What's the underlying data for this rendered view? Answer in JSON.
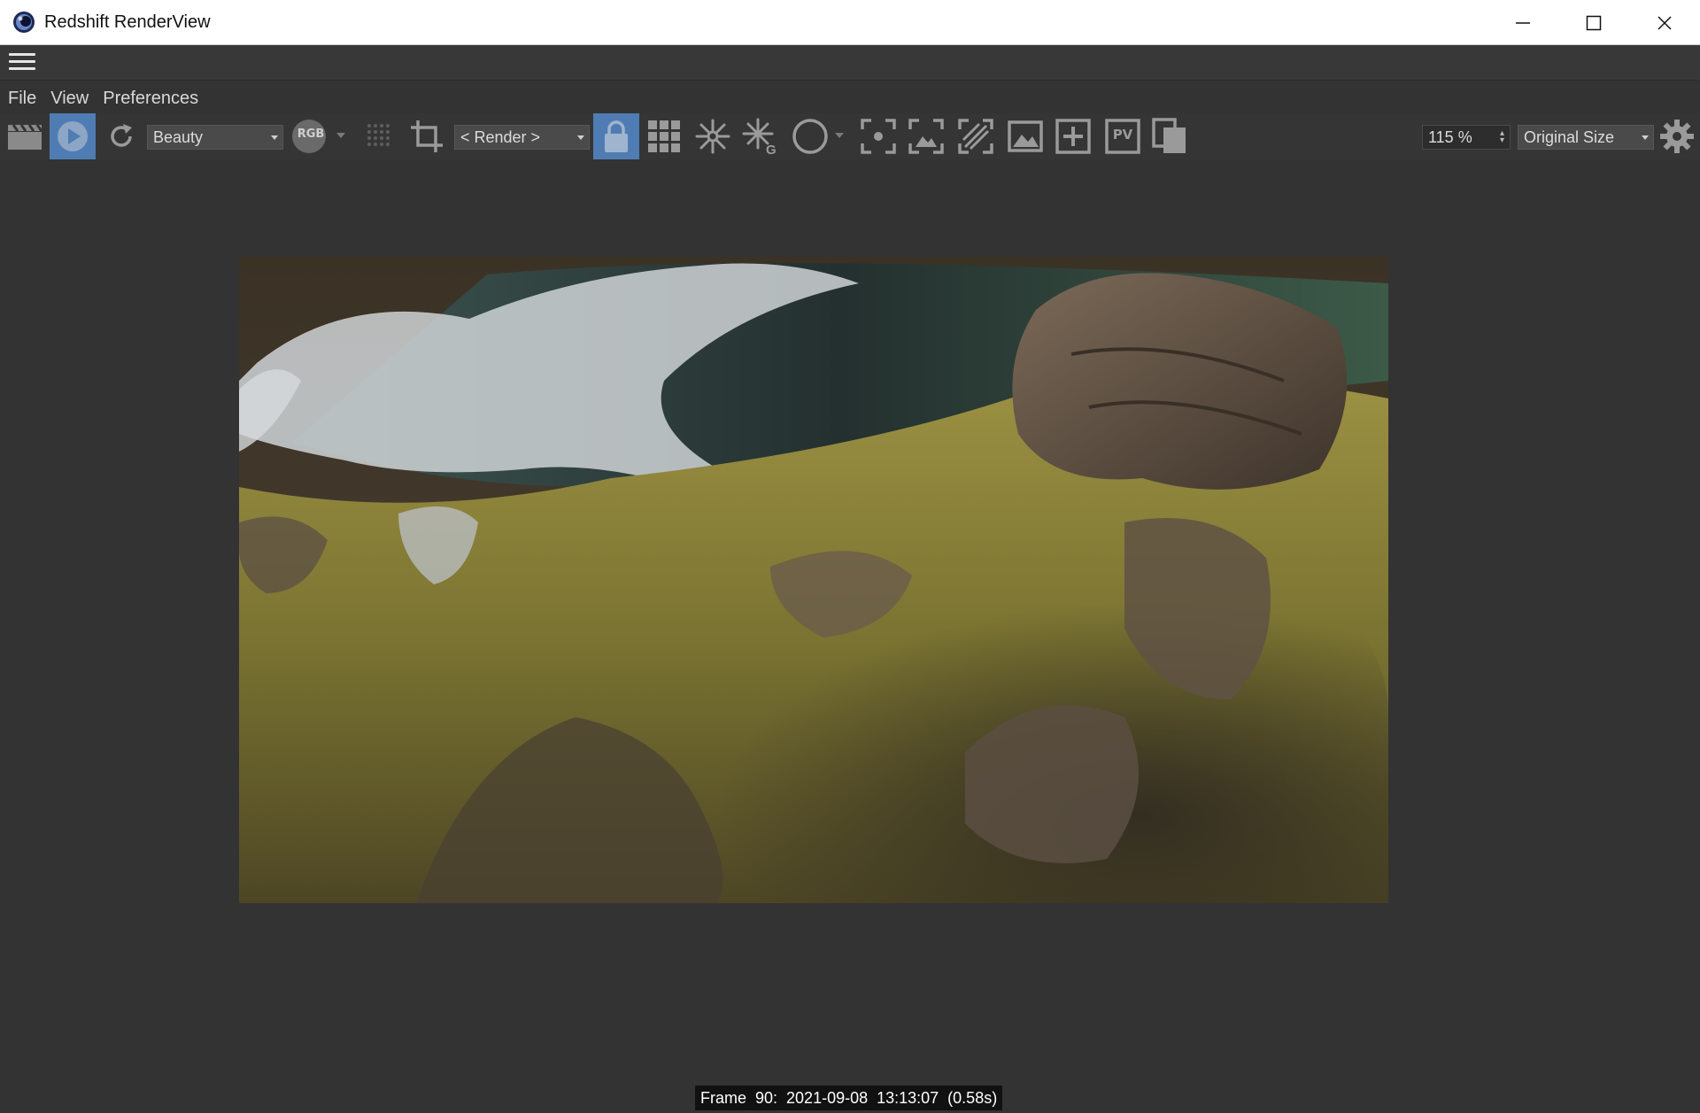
{
  "window": {
    "title": "Redshift RenderView"
  },
  "menu": {
    "items": [
      "File",
      "View",
      "Preferences"
    ]
  },
  "toolbar": {
    "aov_selected": "Beauty",
    "channel_badge": "RGB",
    "camera_selected": "< Render >",
    "snapshot_label": "PV",
    "zoom_value": "115 %",
    "size_selected": "Original Size"
  },
  "status": {
    "frame_text": "Frame  90:  2021-09-08  13:13:07  (0.58s)"
  },
  "colors": {
    "accent": "#4f7db3",
    "background": "#333333",
    "toolbar": "#353535"
  },
  "icons": [
    "app-logo-icon",
    "hamburger-icon",
    "minimize-icon",
    "maximize-icon",
    "close-icon",
    "clapperboard-icon",
    "play-icon",
    "refresh-icon",
    "grid-dots-icon",
    "crop-icon",
    "lock-icon",
    "grid-icon",
    "snowflake-icon",
    "snowflake-g-icon",
    "circle-icon",
    "focus-icon",
    "fit-icon",
    "hatch-icon",
    "image-icon",
    "add-icon",
    "copy-icon",
    "gear-icon"
  ]
}
